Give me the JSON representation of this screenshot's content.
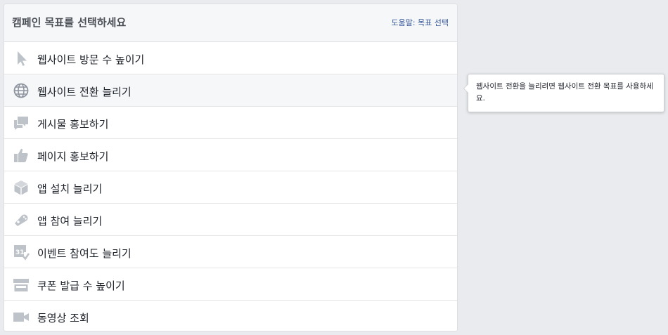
{
  "header": {
    "title": "캠페인 목표를 선택하세요",
    "help": "도움말: 목표 선택"
  },
  "goals": [
    {
      "label": "웹사이트 방문 수 높이기",
      "icon": "cursor-icon"
    },
    {
      "label": "웹사이트 전환 늘리기",
      "icon": "globe-icon"
    },
    {
      "label": "게시물 홍보하기",
      "icon": "speech-bubbles-icon"
    },
    {
      "label": "페이지 홍보하기",
      "icon": "thumbs-up-icon"
    },
    {
      "label": "앱 설치 늘리기",
      "icon": "box-icon"
    },
    {
      "label": "앱 참여 늘리기",
      "icon": "gamepad-icon"
    },
    {
      "label": "이벤트 참여도 늘리기",
      "icon": "calendar-icon"
    },
    {
      "label": "쿠폰 발급 수 높이기",
      "icon": "store-icon"
    },
    {
      "label": "동영상 조회",
      "icon": "video-camera-icon"
    }
  ],
  "tooltip": {
    "text": "웹사이트 전환을 늘리려면 웹사이트 전환 목표를 사용하세요."
  },
  "colors": {
    "icon": "#bec3c9",
    "link": "#365899",
    "text": "#1d2129",
    "background": "#e9ebee"
  }
}
